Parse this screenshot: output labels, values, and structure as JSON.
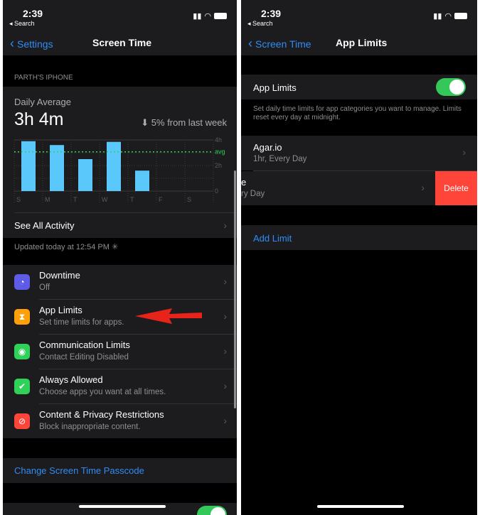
{
  "left": {
    "status": {
      "time": "2:39",
      "back_app": "◂ Search"
    },
    "nav": {
      "back_label": "Settings",
      "title": "Screen Time"
    },
    "device_label": "PARTH'S IPHONE",
    "summary": {
      "heading": "Daily Average",
      "value": "3h 4m",
      "change": "5% from last week",
      "change_icon": "arrow-down-circle-icon"
    },
    "see_all": "See All Activity",
    "updated": "Updated today at 12:54 PM",
    "items": [
      {
        "title": "Downtime",
        "subtitle": "Off",
        "icon": "downtime-icon",
        "color": "#5e5ce6",
        "glyph": "◔"
      },
      {
        "title": "App Limits",
        "subtitle": "Set time limits for apps.",
        "icon": "hourglass-icon",
        "color": "#ff9f0a",
        "glyph": "⧗"
      },
      {
        "title": "Communication Limits",
        "subtitle": "Contact Editing Disabled",
        "icon": "person-circle-icon",
        "color": "#30d158",
        "glyph": "◉"
      },
      {
        "title": "Always Allowed",
        "subtitle": "Choose apps you want at all times.",
        "icon": "checkmark-seal-icon",
        "color": "#30d158",
        "glyph": "✔"
      },
      {
        "title": "Content & Privacy Restrictions",
        "subtitle": "Block inappropriate content.",
        "icon": "restricted-icon",
        "color": "#ff453a",
        "glyph": "⊘"
      }
    ],
    "passcode": "Change Screen Time Passcode",
    "annotation_color": "#e8231a"
  },
  "chart_data": {
    "type": "bar",
    "categories": [
      "S",
      "M",
      "T",
      "W",
      "T",
      "F",
      "S"
    ],
    "values": [
      3.9,
      3.6,
      2.5,
      3.85,
      1.6,
      0,
      0
    ],
    "ylim": [
      0,
      4
    ],
    "yticks": [
      "0",
      "2h",
      "4h"
    ],
    "average": 3.07,
    "average_label": "avg",
    "bar_color": "#5ac8fa",
    "avg_color": "#30d158",
    "grid": true
  },
  "right": {
    "status": {
      "time": "2:39",
      "back_app": "◂ Search"
    },
    "nav": {
      "back_label": "Screen Time",
      "title": "App Limits"
    },
    "toggle_label": "App Limits",
    "toggle_on": true,
    "footer": "Set daily time limits for app categories you want to manage. Limits reset every day at midnight.",
    "limits": [
      {
        "title": "Agar.io",
        "subtitle": "1hr, Every Day"
      },
      {
        "title": "e",
        "subtitle": "ry Day"
      }
    ],
    "delete_label": "Delete",
    "add_limit": "Add Limit",
    "accent": "#2f8cf5",
    "delete_color": "#ff453a"
  }
}
